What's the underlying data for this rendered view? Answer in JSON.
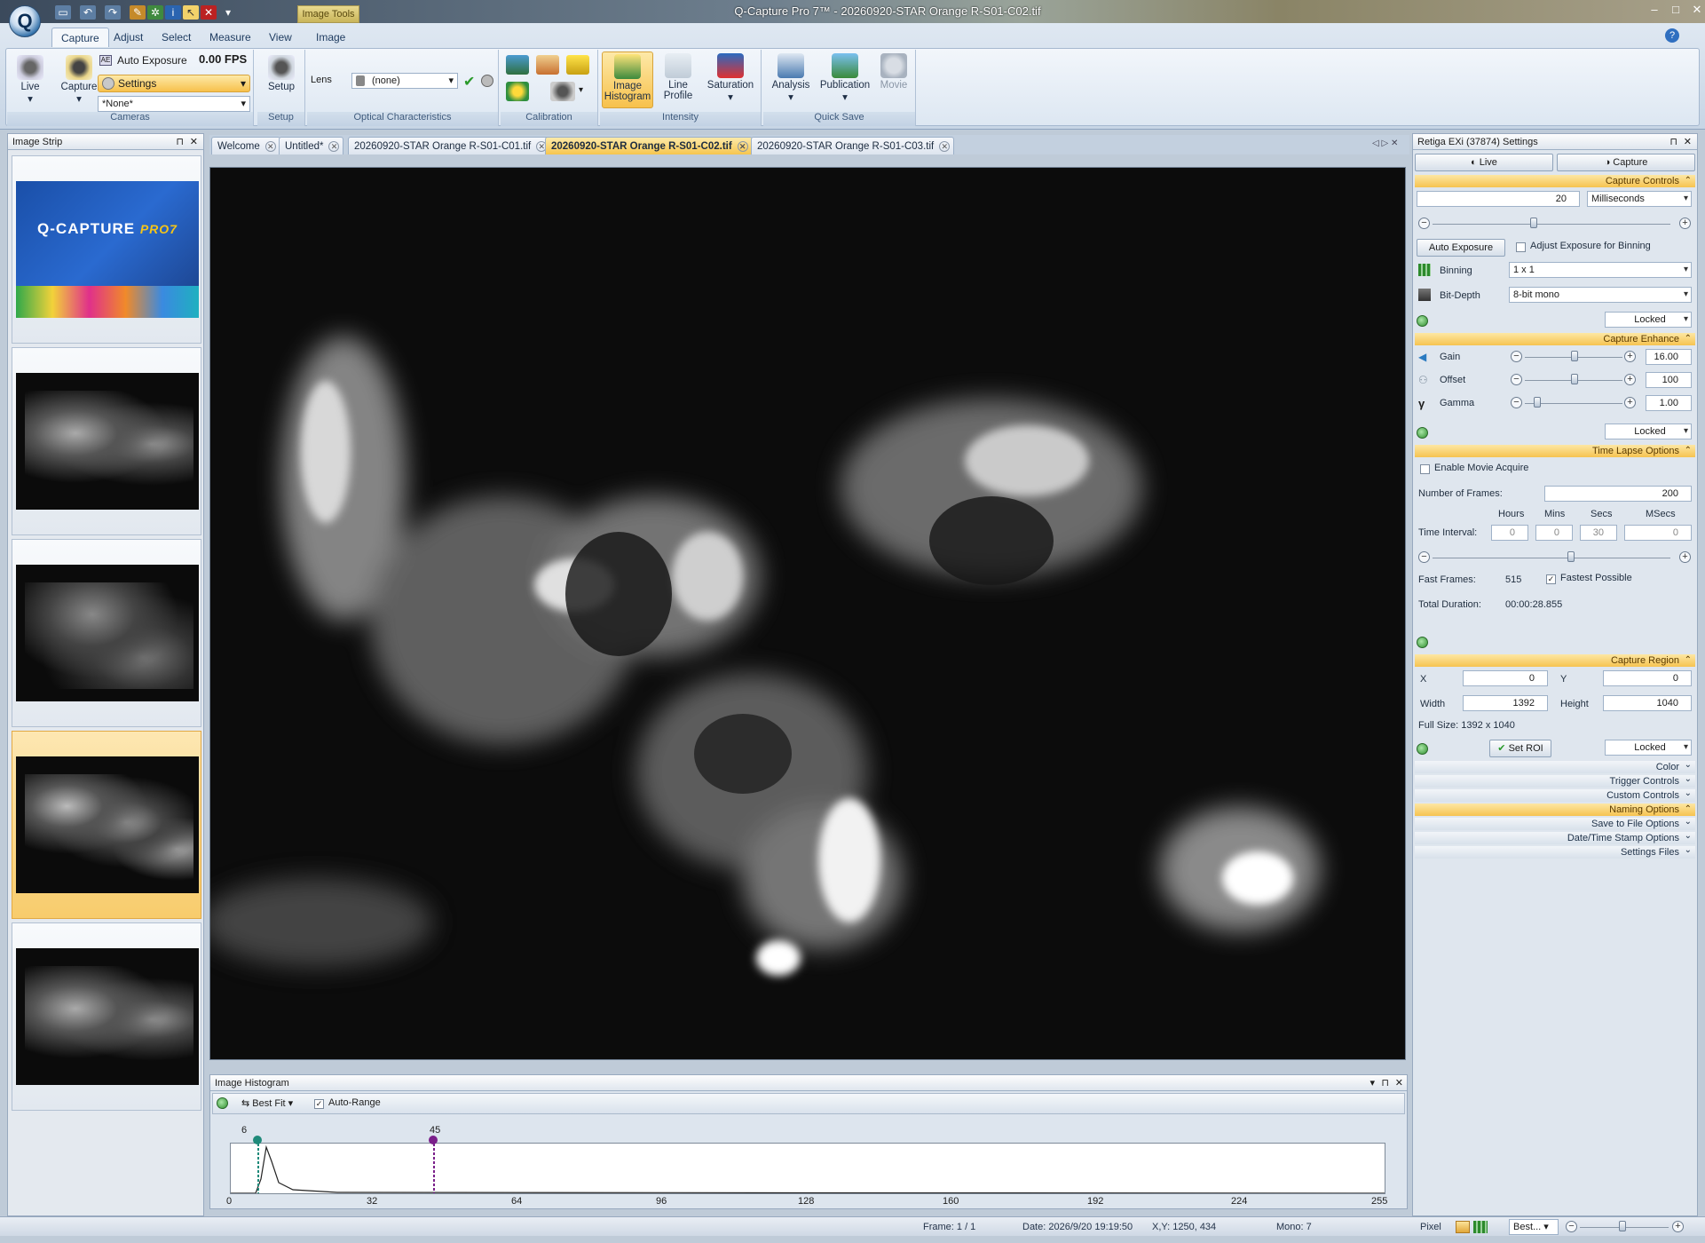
{
  "window": {
    "title": "Q-Capture Pro 7™ - 20260920-STAR Orange R-S01-C02.tif",
    "contextual_tab": "Image Tools"
  },
  "ribbon": {
    "tabs": [
      "Capture",
      "Adjust",
      "Select",
      "Measure",
      "View",
      "Image"
    ],
    "cameras": {
      "live": "Live",
      "capture": "Capture",
      "auto_exposure": "Auto Exposure",
      "fps": "0.00 FPS",
      "settings": "Settings",
      "preset": "*None*",
      "label": "Cameras"
    },
    "setup": {
      "button": "Setup",
      "label": "Setup"
    },
    "optical": {
      "lens_label": "Lens",
      "lens_value": "(none)",
      "label": "Optical Characteristics"
    },
    "calibration": {
      "label": "Calibration"
    },
    "intensity": {
      "image_histogram": "Image Histogram",
      "line_profile": "Line Profile",
      "saturation": "Saturation",
      "label": "Intensity"
    },
    "quicksave": {
      "analysis": "Analysis",
      "publication": "Publication",
      "movie": "Movie",
      "label": "Quick Save"
    }
  },
  "image_strip": {
    "title": "Image Strip",
    "logo_text": "Q-CAPTURE",
    "logo_suffix": "PRO7"
  },
  "doc_tabs": [
    "Welcome",
    "Untitled*",
    "20260920-STAR Orange R-S01-C01.tif",
    "20260920-STAR Orange R-S01-C02.tif",
    "20260920-STAR Orange R-S01-C03.tif"
  ],
  "histogram": {
    "title": "Image Histogram",
    "fit": "Best Fit",
    "auto_range": "Auto-Range",
    "low_marker": "6",
    "high_marker": "45",
    "ticks": [
      "0",
      "32",
      "64",
      "96",
      "128",
      "160",
      "192",
      "224",
      "255"
    ]
  },
  "settings": {
    "title": "Retiga EXi (37874) Settings",
    "live": "Live",
    "capture": "Capture",
    "capture_controls": "Capture Controls",
    "exposure_value": "20",
    "exposure_unit": "Milliseconds",
    "auto_exposure": "Auto Exposure",
    "adjust_binning": "Adjust Exposure for Binning",
    "binning_label": "Binning",
    "binning_value": "1 x 1",
    "bitdepth_label": "Bit-Depth",
    "bitdepth_value": "8-bit mono",
    "locked": "Locked",
    "capture_enhance": "Capture Enhance",
    "gain_label": "Gain",
    "gain_value": "16.00",
    "offset_label": "Offset",
    "offset_value": "100",
    "gamma_label": "Gamma",
    "gamma_value": "1.00",
    "time_lapse": "Time Lapse Options",
    "enable_movie": "Enable Movie Acquire",
    "frames_label": "Number of Frames:",
    "frames_value": "200",
    "hours": "Hours",
    "mins": "Mins",
    "secs": "Secs",
    "msecs": "MSecs",
    "interval_label": "Time Interval:",
    "interval_h": "0",
    "interval_m": "0",
    "interval_s": "30",
    "interval_ms": "0",
    "fast_frames_label": "Fast Frames:",
    "fast_frames_value": "515",
    "fastest": "Fastest Possible",
    "total_label": "Total Duration:",
    "total_value": "00:00:28.855",
    "capture_region": "Capture Region",
    "x_label": "X",
    "x_value": "0",
    "y_label": "Y",
    "y_value": "0",
    "width_label": "Width",
    "width_value": "1392",
    "height_label": "Height",
    "height_value": "1040",
    "full_size": "Full Size: 1392 x 1040",
    "set_roi": "Set ROI",
    "collapsed": [
      "Color",
      "Trigger Controls",
      "Custom Controls",
      "Naming Options",
      "Save to File Options",
      "Date/Time Stamp Options",
      "Settings Files"
    ]
  },
  "status": {
    "frame": "Frame: 1 / 1",
    "date": "Date: 2026/9/20 19:19:50",
    "xy": "X,Y: 1250,  434",
    "mono": "Mono:     7",
    "unit": "Pixel",
    "zoom": "Best..."
  }
}
